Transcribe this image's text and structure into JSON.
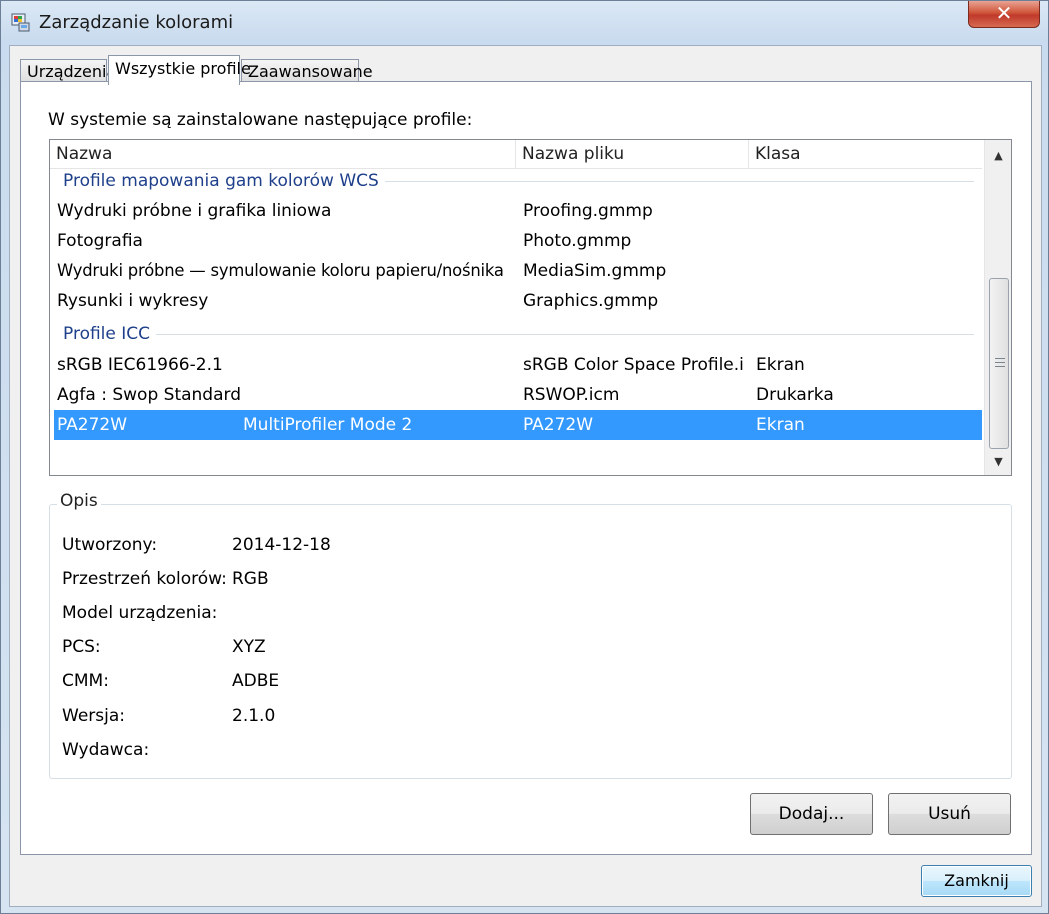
{
  "window": {
    "title": "Zarządzanie kolorami",
    "close_glyph": "✕"
  },
  "tabs": [
    {
      "label": "Urządzenia"
    },
    {
      "label": "Wszystkie profile"
    },
    {
      "label": "Zaawansowane"
    }
  ],
  "intro": "W systemie są zainstalowane następujące profile:",
  "list": {
    "columns": [
      "Nazwa",
      "Nazwa pliku",
      "Klasa"
    ],
    "groups": [
      {
        "title": "Profile mapowania gam kolorów WCS",
        "rows": [
          {
            "name": "Wydruki próbne i grafika liniowa",
            "file": "Proofing.gmmp",
            "class": ""
          },
          {
            "name": "Fotografia",
            "file": "Photo.gmmp",
            "class": ""
          },
          {
            "name": "Wydruki próbne — symulowanie koloru papieru/nośnika",
            "file": "MediaSim.gmmp",
            "class": ""
          },
          {
            "name": "Rysunki i wykresy",
            "file": "Graphics.gmmp",
            "class": ""
          }
        ]
      },
      {
        "title": "Profile ICC",
        "rows": [
          {
            "name": "sRGB IEC61966-2.1",
            "file": "sRGB Color Space Profile.i...",
            "class": "Ekran"
          },
          {
            "name": "Agfa : Swop Standard",
            "file": "RSWOP.icm",
            "class": "Drukarka"
          },
          {
            "name_a": "PA272W",
            "name_b": "MultiProfiler Mode 2",
            "file": "PA272W",
            "class": "Ekran",
            "selected": true
          }
        ]
      }
    ],
    "scroll_up": "▲",
    "scroll_down": "▼"
  },
  "description": {
    "title": "Opis",
    "properties": [
      {
        "label": "Utworzony:",
        "value": "2014-12-18"
      },
      {
        "label": "Przestrzeń kolorów:",
        "value": "RGB"
      },
      {
        "label": "Model urządzenia:",
        "value": ""
      },
      {
        "label": "PCS:",
        "value": "XYZ"
      },
      {
        "label": "CMM:",
        "value": "ADBE"
      },
      {
        "label": "Wersja:",
        "value": "2.1.0"
      },
      {
        "label": "Wydawca:",
        "value": ""
      }
    ]
  },
  "buttons": {
    "add": "Dodaj...",
    "remove": "Usuń",
    "close": "Zamknij"
  }
}
